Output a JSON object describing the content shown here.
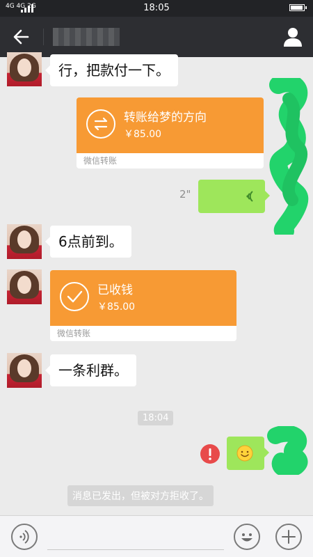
{
  "status_bar": {
    "network": "4G 4G 2G",
    "time": "18:05"
  },
  "title_bar": {
    "back_icon": "arrow-left-icon",
    "contact_name": "萝",
    "profile_icon": "person-icon"
  },
  "messages": {
    "msg1_text": "行，把款付一下。",
    "transfer_sent": {
      "title": "转账给梦的方向",
      "amount": "￥85.00",
      "footer": "微信转账"
    },
    "voice": {
      "duration": "2\""
    },
    "msg2_text": "6点前到。",
    "transfer_received": {
      "title": "已收钱",
      "amount": "￥85.00",
      "footer": "微信转账"
    },
    "msg3_text": "一条利群。",
    "timestamp": "18:04",
    "failed_icon": "exclamation-icon",
    "emoji_icon": "smiley-icon",
    "system_notice": "消息已发出，但被对方拒收了。"
  },
  "bottom_bar": {
    "voice_icon": "voice-input-icon",
    "emoji_icon": "emoji-icon",
    "plus_icon": "plus-icon"
  },
  "colors": {
    "title_bar_bg": "#2d2e32",
    "chat_bg": "#ebebeb",
    "transfer_card": "#f79a34",
    "sent_bubble": "#9ee65b",
    "error_red": "#e84a4a",
    "scribble_green": "#22d36b"
  }
}
